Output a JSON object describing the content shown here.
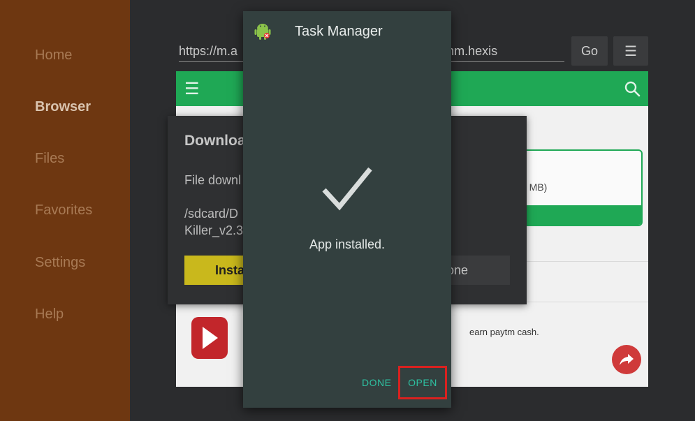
{
  "sidebar": {
    "items": [
      {
        "label": "Home"
      },
      {
        "label": "Browser",
        "active": true
      },
      {
        "label": "Files"
      },
      {
        "label": "Favorites"
      },
      {
        "label": "Settings"
      },
      {
        "label": "Help"
      }
    ]
  },
  "browser": {
    "url": "https://m.a                                          er/com.rhythm.hexis",
    "go_label": "Go",
    "menu_icon": "hamburger-icon",
    "webpage": {
      "download_size": "5 MB)",
      "ad_text": "earn paytm cash."
    }
  },
  "download_dialog": {
    "title": "Downloa",
    "message": "File downl",
    "path": "/sdcard/D\nKiller_v2.3",
    "install_label": "Insta",
    "done_label": "one"
  },
  "task_manager": {
    "title": "Task Manager",
    "icon": "android-icon",
    "message": "App installed.",
    "done_label": "DONE",
    "open_label": "OPEN"
  },
  "colors": {
    "sidebar_bg": "#6e3711",
    "accent_green": "#1fa855",
    "dialog_bg": "#33403f",
    "teal_text": "#2ec1a1",
    "highlight_red": "#d9211f"
  }
}
